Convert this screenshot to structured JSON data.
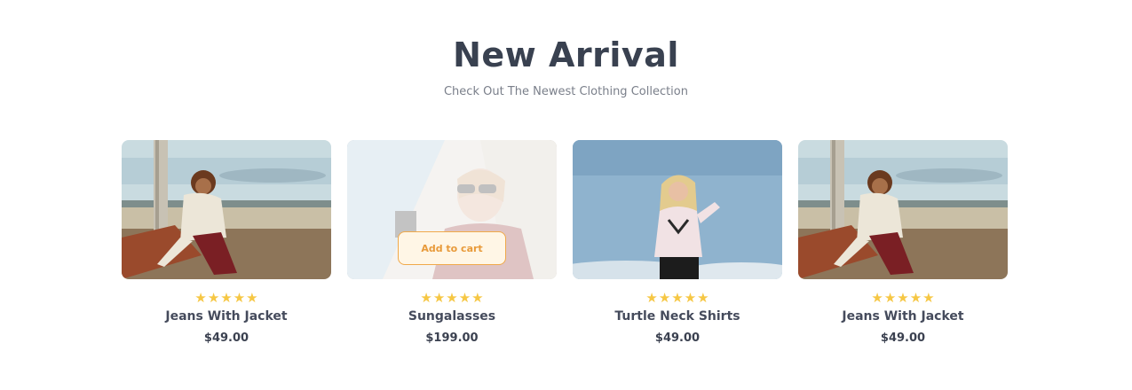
{
  "section": {
    "title": "New Arrival",
    "subtitle": "Check Out The Newest Clothing Collection"
  },
  "products": [
    {
      "name": "Jeans With Jacket",
      "price": "$49.00",
      "rating": 5,
      "image": "woman-sitting-by-beach"
    },
    {
      "name": "Sungalasses",
      "price": "$199.00",
      "rating": 5,
      "image": "woman-with-sunglasses",
      "hover_button": "Add to cart"
    },
    {
      "name": "Turtle Neck Shirts",
      "price": "$49.00",
      "rating": 5,
      "image": "woman-against-sky"
    },
    {
      "name": "Jeans With Jacket",
      "price": "$49.00",
      "rating": 5,
      "image": "woman-sitting-by-beach"
    }
  ],
  "colors": {
    "star": "#f6c744",
    "accent": "#e89a3a"
  }
}
